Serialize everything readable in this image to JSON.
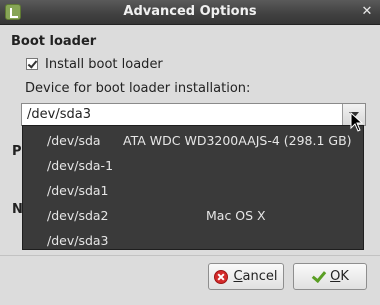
{
  "window": {
    "title": "Advanced Options",
    "icon": "mint-app-icon",
    "close_glyph": "✕"
  },
  "boot_loader": {
    "section_title": "Boot loader",
    "install_label": "Install boot loader",
    "install_checked": true,
    "device_label": "Device for boot loader installation:",
    "selected_device": "/dev/sda3"
  },
  "dropdown": {
    "options": [
      {
        "device": "/dev/sda",
        "description": "ATA WDC WD3200AAJS-4 (298.1 GB)"
      },
      {
        "device": "/dev/sda-1",
        "description": ""
      },
      {
        "device": "/dev/sda1",
        "description": ""
      },
      {
        "device": "/dev/sda2",
        "description": "Mac OS X"
      },
      {
        "device": "/dev/sda3",
        "description": ""
      }
    ]
  },
  "behind_dropdown": {
    "partial_label_1": "P",
    "partial_label_2": "N"
  },
  "buttons": {
    "cancel_mnemonic": "C",
    "cancel_rest": "ancel",
    "ok_mnemonic": "O",
    "ok_rest": "K"
  },
  "colors": {
    "titlebar": "#404040",
    "dropdown_bg": "#3a3a3a",
    "cancel_icon": "#d42a2a",
    "ok_icon": "#5a9e24"
  }
}
